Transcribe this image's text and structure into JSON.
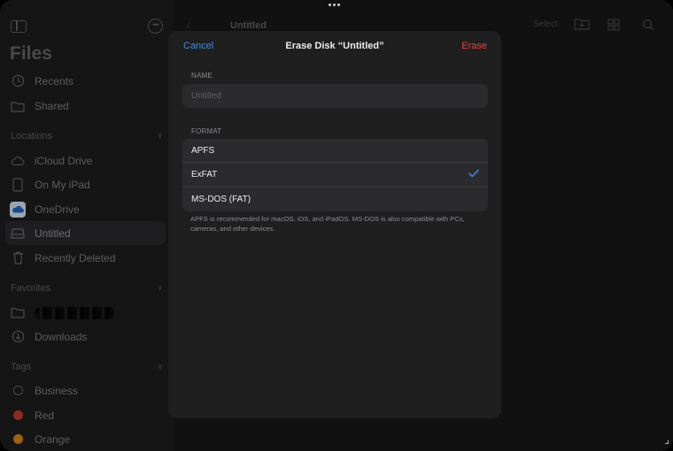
{
  "sidebar": {
    "title": "Files",
    "items_top": [
      {
        "label": "Recents",
        "icon": "clock-icon"
      },
      {
        "label": "Shared",
        "icon": "shared-folder-icon"
      }
    ],
    "sections": {
      "locations": "Locations",
      "favorites": "Favorites",
      "tags": "Tags"
    },
    "locations": [
      {
        "label": "iCloud Drive",
        "icon": "cloud-icon"
      },
      {
        "label": "On My iPad",
        "icon": "ipad-icon"
      },
      {
        "label": "OneDrive",
        "icon": "onedrive-icon"
      },
      {
        "label": "Untitled",
        "icon": "drive-icon",
        "selected": true
      },
      {
        "label": "Recently Deleted",
        "icon": "trash-icon"
      }
    ],
    "favorites": [
      {
        "label": "",
        "icon": "folder-icon",
        "redacted": true
      },
      {
        "label": "Downloads",
        "icon": "download-icon"
      }
    ],
    "tags": [
      {
        "label": "Business",
        "color": ""
      },
      {
        "label": "Red",
        "color": "#c8332c"
      },
      {
        "label": "Orange",
        "color": "#d98a17"
      }
    ]
  },
  "main": {
    "title": "Untitled",
    "select_label": "Select"
  },
  "dialog": {
    "cancel_label": "Cancel",
    "title": "Erase Disk “Untitled”",
    "erase_label": "Erase",
    "name_section": "NAME",
    "name_placeholder": "Untitled",
    "name_value": "",
    "format_section": "FORMAT",
    "formats": [
      {
        "label": "APFS",
        "selected": false
      },
      {
        "label": "ExFAT",
        "selected": true
      },
      {
        "label": "MS-DOS (FAT)",
        "selected": false
      }
    ],
    "help": "APFS is recommended for macOS, iOS, and iPadOS. MS-DOS is also compatible with PCs, cameras, and other devices."
  },
  "colors": {
    "accent": "#3f8ae5",
    "destructive": "#e5443c"
  }
}
